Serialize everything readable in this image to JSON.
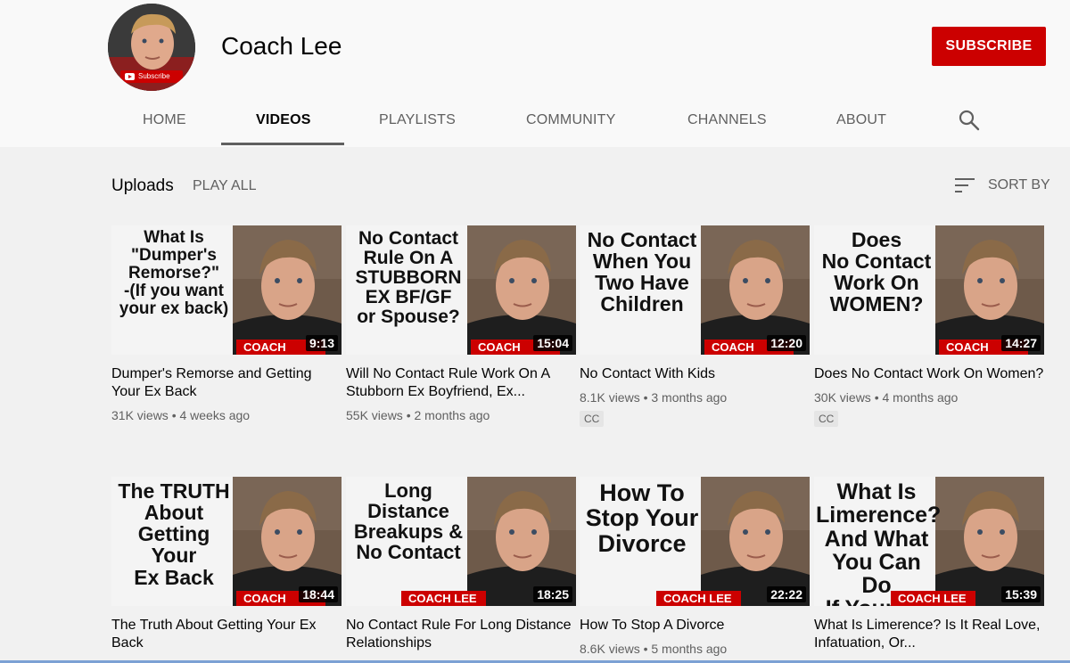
{
  "channel": {
    "name": "Coach Lee",
    "avatar_badge": "Subscribe",
    "subscribe_label": "SUBSCRIBE"
  },
  "tabs": [
    {
      "label": "HOME",
      "active": false
    },
    {
      "label": "VIDEOS",
      "active": true
    },
    {
      "label": "PLAYLISTS",
      "active": false
    },
    {
      "label": "COMMUNITY",
      "active": false
    },
    {
      "label": "CHANNELS",
      "active": false
    },
    {
      "label": "ABOUT",
      "active": false
    }
  ],
  "section": {
    "title": "Uploads",
    "play_all": "PLAY ALL",
    "sort_by": "SORT BY"
  },
  "videos": [
    {
      "thumb_text": "What Is\n\"Dumper's\nRemorse?\"\n-(If you want\nyour ex back)",
      "brand": "COACH",
      "duration": "9:13",
      "title": "Dumper's Remorse and Getting Your Ex Back",
      "meta": "31K views • 4 weeks ago",
      "cc": ""
    },
    {
      "thumb_text": "No Contact\nRule On A\nSTUBBORN\nEX BF/GF\nor Spouse?",
      "brand": "COACH",
      "duration": "15:04",
      "title": "Will No Contact Rule Work On A Stubborn Ex Boyfriend, Ex...",
      "meta": "55K views • 2 months ago",
      "cc": ""
    },
    {
      "thumb_text": "No Contact\nWhen You\nTwo Have\nChildren",
      "brand": "COACH",
      "duration": "12:20",
      "title": "No Contact With Kids",
      "meta": "8.1K views • 3 months ago",
      "cc": "CC"
    },
    {
      "thumb_text": "Does\nNo Contact\nWork On\nWOMEN?",
      "brand": "COACH",
      "duration": "14:27",
      "title": "Does No Contact Work On Women?",
      "meta": "30K views • 4 months ago",
      "cc": "CC"
    },
    {
      "thumb_text": "The TRUTH\nAbout\nGetting Your\nEx Back",
      "brand": "COACH",
      "duration": "18:44",
      "title": "The Truth About Getting Your Ex Back",
      "meta": "",
      "cc": ""
    },
    {
      "thumb_text": "Long Distance\nBreakups &\nNo Contact",
      "brand": "COACH LEE",
      "duration": "18:25",
      "title": "No Contact Rule For Long Distance Relationships",
      "meta": "",
      "cc": ""
    },
    {
      "thumb_text": "How To\nStop Your\nDivorce",
      "brand": "COACH LEE",
      "duration": "22:22",
      "title": "How To Stop A Divorce",
      "meta": "8.6K views • 5 months ago",
      "cc": ""
    },
    {
      "thumb_text": "What Is\nLimerence?\nAnd What You Can Do\nIf Your Ex Is In It...",
      "brand": "COACH LEE",
      "duration": "15:39",
      "title": "What Is Limerence? Is It Real Love, Infatuation, Or...",
      "meta": "",
      "cc": ""
    }
  ]
}
